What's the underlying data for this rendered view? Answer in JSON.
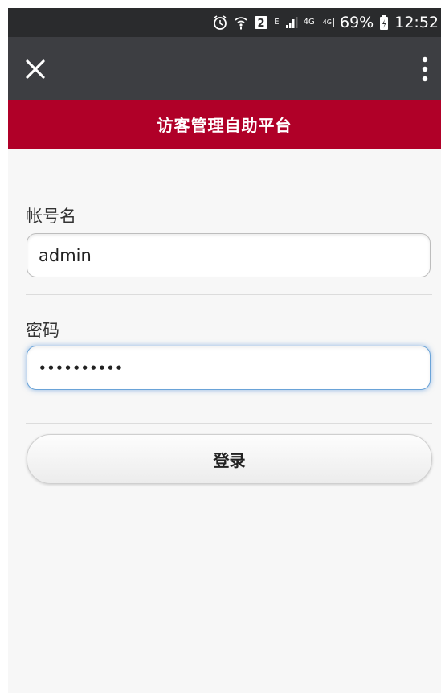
{
  "status_bar": {
    "battery": "69%",
    "time": "12:52",
    "signal_labels": [
      "E",
      "4G"
    ],
    "net_label": "4G"
  },
  "toolbar": {
    "close_icon": "close-icon",
    "menu_icon": "more-vert-icon"
  },
  "header": {
    "title": "访客管理自助平台"
  },
  "form": {
    "username_label": "帐号名",
    "username_value": "admin",
    "password_label": "密码",
    "password_value": "••••••••••",
    "login_label": "登录"
  },
  "colors": {
    "header_bg": "#b00028",
    "toolbar_bg": "#3d3e42",
    "statusbar_bg": "#2a2b2d",
    "focus_ring": "#6aa3d8"
  }
}
